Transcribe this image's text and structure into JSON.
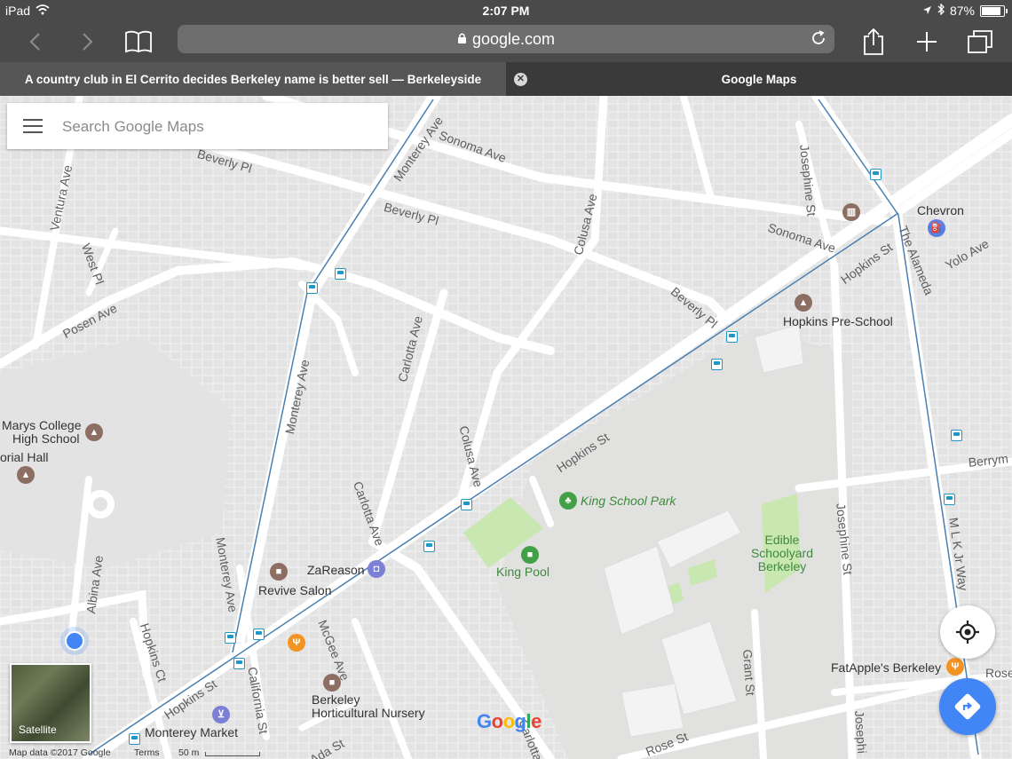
{
  "status_bar": {
    "device": "iPad",
    "time": "2:07 PM",
    "battery_percent": "87%",
    "battery_level": 0.87
  },
  "browser": {
    "url": "google.com",
    "tabs": [
      {
        "title": "A country club in El Cerrito decides Berkeley name is better sell — Berkeleyside"
      },
      {
        "title": "Google Maps"
      }
    ],
    "close_glyph": "✕"
  },
  "search": {
    "placeholder": "Search Google Maps"
  },
  "map": {
    "streets": {
      "monterey_ave_top": "Monterey Ave",
      "sonoma_ave_top": "Sonoma Ave",
      "beverly_pl_1": "Beverly Pl",
      "beverly_pl_2": "Beverly Pl",
      "beverly_pl_3": "Beverly Pl",
      "ventura_ave": "Ventura Ave",
      "west_pl": "West Pl",
      "posen_ave": "Posen Ave",
      "colusa_ave_top": "Colusa Ave",
      "colusa_ave_mid": "Colusa Ave",
      "carlotta_ave_top": "Carlotta Ave",
      "carlotta_ave_mid": "Carlotta Ave",
      "carlotta_ave_bottom": "Carlotta",
      "monterey_ave_mid": "Monterey Ave",
      "monterey_ave_low": "Monterey Ave",
      "josephine_st_top": "Josephine St",
      "josephine_st_mid": "Josephine St",
      "josephine_st_bottom": "Josephi",
      "sonoma_ave_right": "Sonoma Ave",
      "hopkins_st_right": "Hopkins St",
      "hopkins_st_mid": "Hopkins St",
      "hopkins_st_left": "Hopkins St",
      "the_alameda": "The Alameda",
      "yolo_ave": "Yolo Ave",
      "berryman": "Berrym",
      "mlk_jr_way": "M L K Jr Way",
      "albina_ave": "Albina Ave",
      "hopkins_ct": "Hopkins Ct",
      "california_st": "California St",
      "mcgee_ave": "McGee Ave",
      "ada_st": "Ada St",
      "grant_st": "Grant St",
      "rose_st": "Rose St",
      "rose_right": "Rose"
    },
    "places": {
      "chevron": "Chevron",
      "hopkins_preschool": "Hopkins Pre-School",
      "marys_college_line1": "Marys College",
      "marys_college_line2": "High School",
      "orial_hall": "orial Hall",
      "king_school_park": "King School Park",
      "king_pool": "King Pool",
      "edible_line1": "Edible",
      "edible_line2": "Schoolyard",
      "edible_line3": "Berkeley",
      "zareason": "ZaReason",
      "revive_salon": "Revive Salon",
      "berkeley_nursery_line1": "Berkeley",
      "berkeley_nursery_line2": "Horticultural Nursery",
      "monterey_market": "Monterey Market",
      "fatapples": "FatApple's Berkeley"
    },
    "satellite_label": "Satellite",
    "attribution": "Map data ©2017 Google",
    "terms": "Terms",
    "scale": "50 m",
    "logo_letters": [
      "G",
      "o",
      "o",
      "g",
      "l",
      "e"
    ],
    "colors": {
      "road": "#ffffff",
      "block": "#e4e4e4",
      "park": "#c9e7b0",
      "transit_line": "#4a7fb0",
      "accent_blue": "#4285f4"
    }
  }
}
